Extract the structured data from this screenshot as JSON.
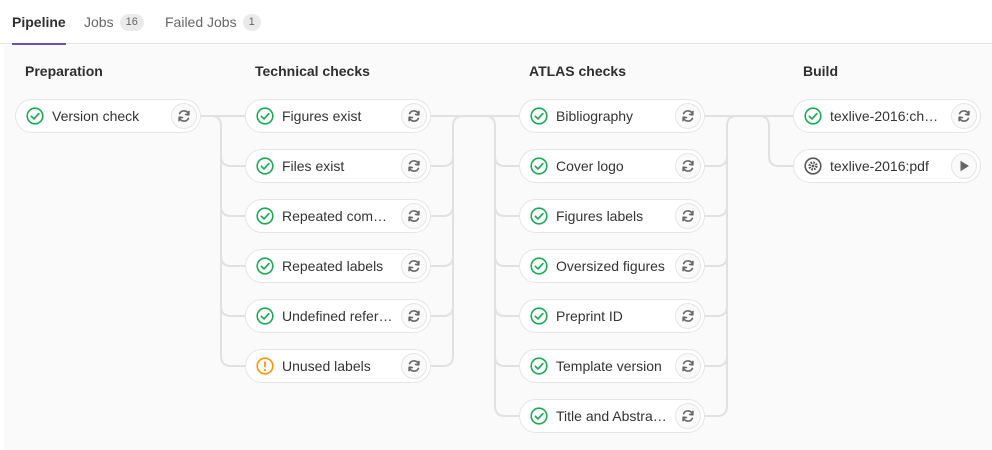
{
  "tabs": [
    {
      "label": "Pipeline",
      "count": null,
      "active": true
    },
    {
      "label": "Jobs",
      "count": "16",
      "active": false
    },
    {
      "label": "Failed Jobs",
      "count": "1",
      "active": false
    }
  ],
  "stages": [
    {
      "title": "Preparation",
      "jobs": [
        {
          "name": "Version check",
          "status": "success-icon",
          "action": "retry-icon"
        }
      ]
    },
    {
      "title": "Technical checks",
      "jobs": [
        {
          "name": "Figures exist",
          "status": "success-icon",
          "action": "retry-icon"
        },
        {
          "name": "Files exist",
          "status": "success-icon",
          "action": "retry-icon"
        },
        {
          "name": "Repeated com…",
          "status": "success-icon",
          "action": "retry-icon"
        },
        {
          "name": "Repeated labels",
          "status": "success-icon",
          "action": "retry-icon"
        },
        {
          "name": "Undefined refer…",
          "status": "success-icon",
          "action": "retry-icon"
        },
        {
          "name": "Unused labels",
          "status": "warning-icon",
          "action": "retry-icon"
        }
      ]
    },
    {
      "title": "ATLAS checks",
      "jobs": [
        {
          "name": "Bibliography",
          "status": "success-icon",
          "action": "retry-icon"
        },
        {
          "name": "Cover logo",
          "status": "success-icon",
          "action": "retry-icon"
        },
        {
          "name": "Figures labels",
          "status": "success-icon",
          "action": "retry-icon"
        },
        {
          "name": "Oversized figures",
          "status": "success-icon",
          "action": "retry-icon"
        },
        {
          "name": "Preprint ID",
          "status": "success-icon",
          "action": "retry-icon"
        },
        {
          "name": "Template version",
          "status": "success-icon",
          "action": "retry-icon"
        },
        {
          "name": "Title and Abstra…",
          "status": "success-icon",
          "action": "retry-icon"
        }
      ]
    },
    {
      "title": "Build",
      "jobs": [
        {
          "name": "texlive-2016:ch…",
          "status": "success-icon",
          "action": "retry-icon"
        },
        {
          "name": "texlive-2016:pdf",
          "status": "manual-icon",
          "action": "play-icon"
        }
      ]
    }
  ],
  "colors": {
    "success": "#1aaa55",
    "warning": "#fc9403",
    "manual": "#555555",
    "accent": "#6b4fbb",
    "connector": "#e1e1e1"
  }
}
